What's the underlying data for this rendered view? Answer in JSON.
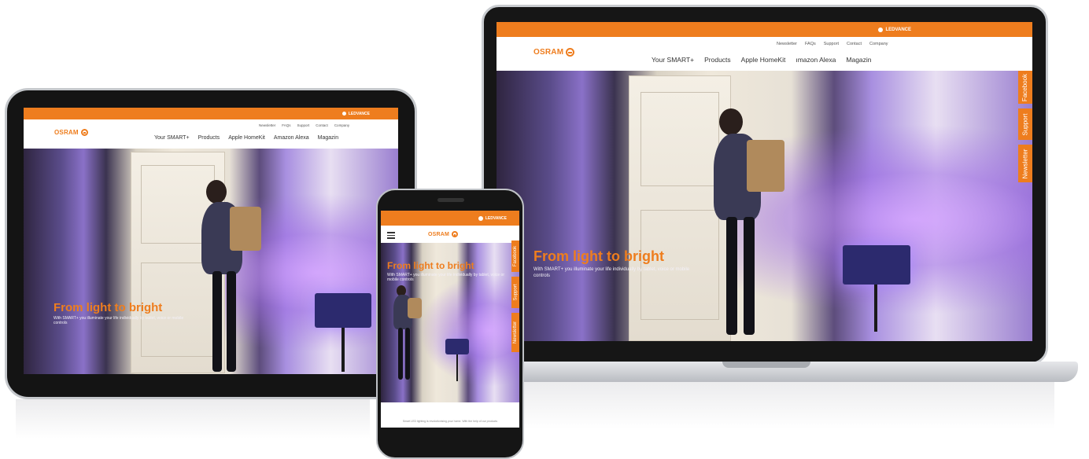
{
  "brand": {
    "logo_text": "OSRAM",
    "topbar_label": "LEDVANCE",
    "accent": "#ee7d1e"
  },
  "utility_nav": [
    "Newsletter",
    "FAQs",
    "Support",
    "Contact",
    "Company"
  ],
  "main_nav": [
    "Your SMART+",
    "Products",
    "Apple HomeKit",
    "Amazon Alexa",
    "Magazin"
  ],
  "laptop_main_nav": [
    "Your SMART+",
    "Products",
    "Apple HomeKit",
    "ımazon Alexa",
    "Magazin"
  ],
  "hero": {
    "title": "From light to bright",
    "subtitle": "With SMART+ you illuminate your life individually by tablet, voice or mobile controls"
  },
  "side_tabs": [
    "Facebook",
    "Support",
    "Newsletter"
  ],
  "phone_footer_text": "Smart LED lighting is revolutionising your home. With the help of our products"
}
